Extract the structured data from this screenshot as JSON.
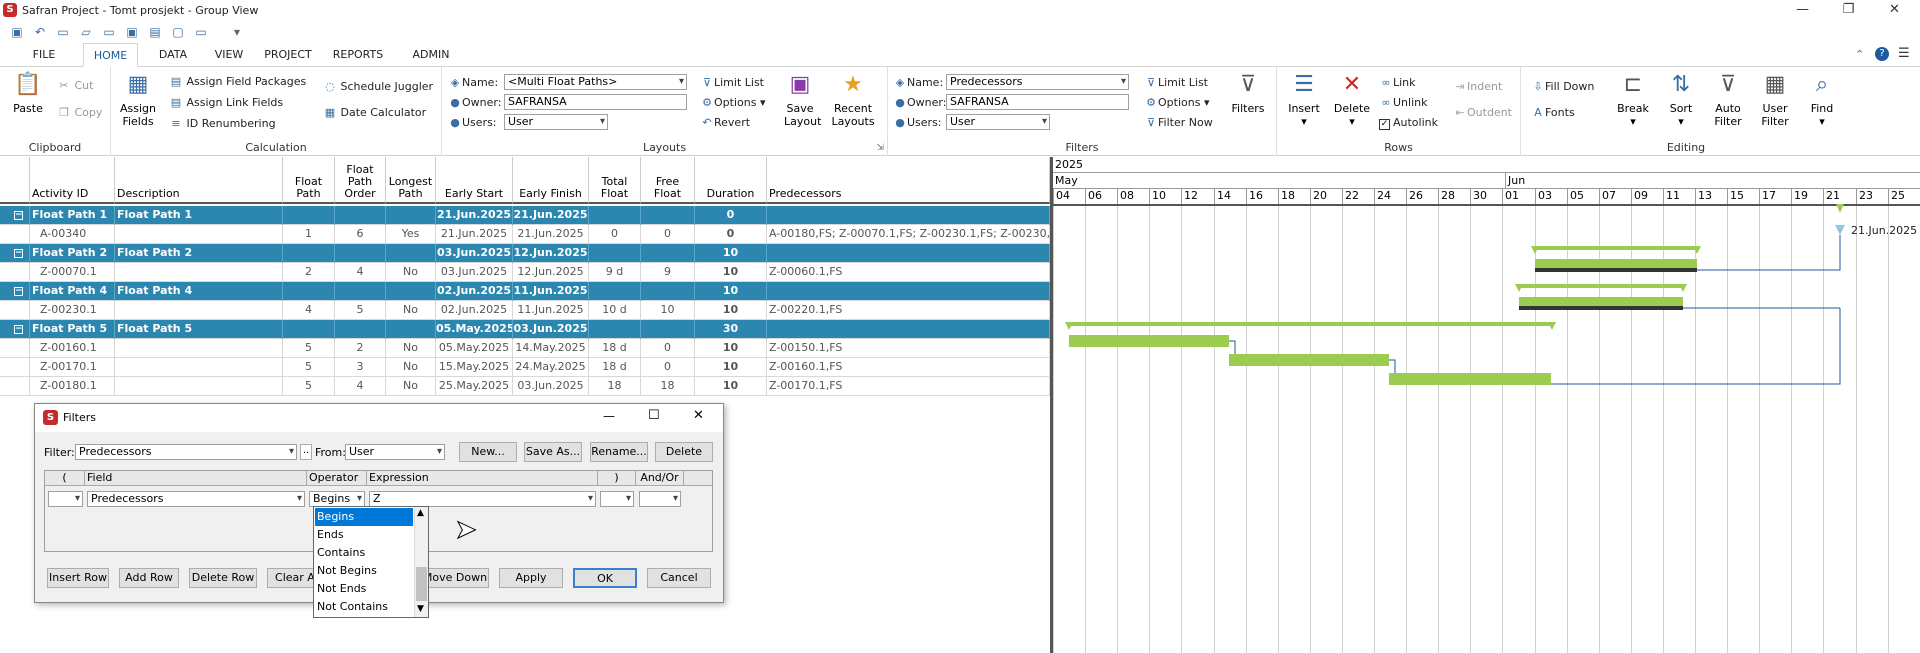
{
  "window": {
    "title": "Safran Project - Tomt prosjekt - Group View",
    "app_icon": "safran-logo-icon"
  },
  "menu": {
    "tabs": [
      "FILE",
      "HOME",
      "DATA",
      "VIEW",
      "PROJECT",
      "REPORTS",
      "ADMIN"
    ],
    "active": "HOME"
  },
  "ribbon": {
    "clipboard": {
      "label": "Clipboard",
      "paste": "Paste",
      "cut": "Cut",
      "copy": "Copy"
    },
    "calculation": {
      "label": "Calculation",
      "assign_fields": "Assign Fields",
      "assign_field_packages": "Assign Field Packages",
      "assign_link_fields": "Assign Link Fields",
      "id_renumbering": "ID Renumbering",
      "schedule_juggler": "Schedule Juggler",
      "date_calculator": "Date Calculator"
    },
    "layouts": {
      "label": "Layouts",
      "name_label": "Name:",
      "name_value": "<Multi Float Paths>",
      "owner_label": "Owner:",
      "owner_value": "SAFRANSA",
      "users_label": "Users:",
      "users_value": "User",
      "limit_list": "Limit List",
      "options": "Options",
      "revert": "Revert",
      "save_layout": "Save Layout",
      "recent_layouts": "Recent Layouts"
    },
    "filters": {
      "label": "Filters",
      "name_label": "Name:",
      "name_value": "Predecessors",
      "owner_label": "Owner:",
      "owner_value": "SAFRANSA",
      "users_label": "Users:",
      "users_value": "User",
      "limit_list": "Limit List",
      "options": "Options",
      "filter_now": "Filter Now",
      "filters": "Filters"
    },
    "rows": {
      "label": "Rows",
      "insert": "Insert",
      "delete": "Delete",
      "link": "Link",
      "unlink": "Unlink",
      "autolink": "Autolink",
      "indent": "Indent",
      "outdent": "Outdent"
    },
    "editing": {
      "label": "Editing",
      "fill_down": "Fill Down",
      "fonts": "Fonts",
      "break": "Break",
      "sort": "Sort",
      "auto_filter": "Auto Filter",
      "user_filter": "User Filter",
      "find": "Find"
    }
  },
  "grid": {
    "headers": [
      "Activity ID",
      "Description",
      "Float Path",
      "Float Path Order",
      "Longest Path",
      "Early Start",
      "Early Finish",
      "Total Float",
      "Free Float",
      "Duration",
      "Predecessors"
    ],
    "rows": [
      {
        "type": "group",
        "id": "Float Path 1",
        "desc": "Float Path 1",
        "fp": "",
        "fpo": "",
        "lp": "",
        "es": "21.Jun.2025",
        "ef": "21.Jun.2025",
        "tf": "",
        "ff": "",
        "dur": "0",
        "pred": ""
      },
      {
        "type": "leaf",
        "id": "A-00340",
        "desc": "",
        "fp": "1",
        "fpo": "6",
        "lp": "Yes",
        "es": "21.Jun.2025",
        "ef": "21.Jun.2025",
        "tf": "0",
        "ff": "0",
        "dur": "0",
        "pred": "A-00180,FS; Z-00070.1,FS; Z-00230.1,FS; Z-00230,FS; Z-"
      },
      {
        "type": "group",
        "id": "Float Path 2",
        "desc": "Float Path 2",
        "fp": "",
        "fpo": "",
        "lp": "",
        "es": "03.Jun.2025",
        "ef": "12.Jun.2025",
        "tf": "",
        "ff": "",
        "dur": "10",
        "pred": ""
      },
      {
        "type": "leaf",
        "id": "Z-00070.1",
        "desc": "",
        "fp": "2",
        "fpo": "4",
        "lp": "No",
        "es": "03.Jun.2025",
        "ef": "12.Jun.2025",
        "tf": "9 d",
        "ff": "9",
        "dur": "10",
        "pred": "Z-00060.1,FS"
      },
      {
        "type": "group",
        "id": "Float Path 4",
        "desc": "Float Path 4",
        "fp": "",
        "fpo": "",
        "lp": "",
        "es": "02.Jun.2025",
        "ef": "11.Jun.2025",
        "tf": "",
        "ff": "",
        "dur": "10",
        "pred": ""
      },
      {
        "type": "leaf",
        "id": "Z-00230.1",
        "desc": "",
        "fp": "4",
        "fpo": "5",
        "lp": "No",
        "es": "02.Jun.2025",
        "ef": "11.Jun.2025",
        "tf": "10 d",
        "ff": "10",
        "dur": "10",
        "pred": "Z-00220.1,FS"
      },
      {
        "type": "group",
        "id": "Float Path 5",
        "desc": "Float Path 5",
        "fp": "",
        "fpo": "",
        "lp": "",
        "es": "05.May.2025",
        "ef": "03.Jun.2025",
        "tf": "",
        "ff": "",
        "dur": "30",
        "pred": ""
      },
      {
        "type": "leaf",
        "id": "Z-00160.1",
        "desc": "",
        "fp": "5",
        "fpo": "2",
        "lp": "No",
        "es": "05.May.2025",
        "ef": "14.May.2025",
        "tf": "18 d",
        "ff": "0",
        "dur": "10",
        "pred": "Z-00150.1,FS"
      },
      {
        "type": "leaf",
        "id": "Z-00170.1",
        "desc": "",
        "fp": "5",
        "fpo": "3",
        "lp": "No",
        "es": "15.May.2025",
        "ef": "24.May.2025",
        "tf": "18 d",
        "ff": "0",
        "dur": "10",
        "pred": "Z-00160.1,FS"
      },
      {
        "type": "leaf",
        "id": "Z-00180.1",
        "desc": "",
        "fp": "5",
        "fpo": "4",
        "lp": "No",
        "es": "25.May.2025",
        "ef": "03.Jun.2025",
        "tf": "18",
        "ff": "18",
        "dur": "10",
        "pred": "Z-00170.1,FS"
      }
    ]
  },
  "gantt": {
    "year": "2025",
    "months": [
      "May",
      "Jun"
    ],
    "days": [
      "04",
      "06",
      "08",
      "10",
      "12",
      "14",
      "16",
      "18",
      "20",
      "22",
      "24",
      "26",
      "28",
      "30",
      "01",
      "03",
      "05",
      "07",
      "09",
      "11",
      "13",
      "15",
      "17",
      "19",
      "21",
      "23",
      "25"
    ],
    "milestone_label": "21.Jun.2025",
    "bar_color": "#9bcb4f"
  },
  "filters_dialog": {
    "title": "Filters",
    "filter_label": "Filter:",
    "filter_value": "Predecessors",
    "dots": "..",
    "from_label": "From:",
    "from_value": "User",
    "new": "New...",
    "save_as": "Save As...",
    "rename": "Rename...",
    "delete": "Delete",
    "cols": {
      "open": "(",
      "field": "Field",
      "operator": "Operator",
      "expression": "Expression",
      "close": ")",
      "andor": "And/Or"
    },
    "row": {
      "field": "Predecessors",
      "operator": "Begins",
      "expression": "Z"
    },
    "insert_row": "Insert Row",
    "add_row": "Add Row",
    "delete_row": "Delete Row",
    "clear_all": "Clear All",
    "move_down": "Move Down",
    "apply": "Apply",
    "ok": "OK",
    "cancel": "Cancel"
  },
  "operator_options": [
    "Begins",
    "Ends",
    "Contains",
    "Not Begins",
    "Not Ends",
    "Not Contains"
  ]
}
